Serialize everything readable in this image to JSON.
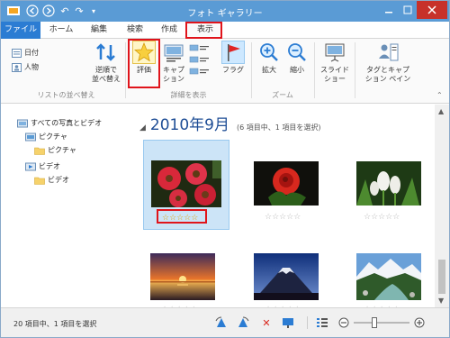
{
  "window": {
    "title": "フォト ギャラリー"
  },
  "tabs": [
    {
      "label": "ファイル"
    },
    {
      "label": "ホーム"
    },
    {
      "label": "編集"
    },
    {
      "label": "検索"
    },
    {
      "label": "作成"
    },
    {
      "label": "表示"
    }
  ],
  "ribbon": {
    "sort": {
      "date": "日付",
      "person": "人物",
      "reverse": "逆順で\n並べ替え",
      "group": "リストの並べ替え"
    },
    "details": {
      "rating": "評価",
      "caption": "キャプ\nション",
      "flag": "フラグ",
      "group": "詳細を表示"
    },
    "zoom": {
      "zoom_in": "拡大",
      "zoom_out": "縮小",
      "group": "ズーム"
    },
    "slideshow": "スライド\nショー",
    "tag_caption_pane": "タグとキャプ\nション ペイン"
  },
  "nav": {
    "items": [
      {
        "label": "すべての写真とビデオ"
      },
      {
        "label": "ピクチャ"
      },
      {
        "label": "ピクチャ"
      },
      {
        "label": "ビデオ"
      },
      {
        "label": "ビデオ"
      }
    ]
  },
  "content": {
    "group_title": "2010年9月",
    "group_count": "(6 項目中、1 項目を選択)",
    "thumbnails": [
      {
        "subject": "red gerbera flowers",
        "rating": "☆☆☆☆☆",
        "selected": true
      },
      {
        "subject": "red rose",
        "rating": "☆☆☆☆☆",
        "selected": false
      },
      {
        "subject": "white tulips",
        "rating": "☆☆☆☆☆",
        "selected": false
      },
      {
        "subject": "sunset over sea",
        "rating": "☆☆☆☆☆",
        "selected": false
      },
      {
        "subject": "mount fuji",
        "rating": "☆☆☆☆☆",
        "selected": false
      },
      {
        "subject": "mountain river",
        "rating": "☆☆☆☆☆",
        "selected": false
      }
    ]
  },
  "status": {
    "text": "20 項目中、1 項目を選択"
  },
  "colors": {
    "accent": "#2b7cd3",
    "highlight": "#e0141b",
    "selection": "#cce4f7"
  }
}
